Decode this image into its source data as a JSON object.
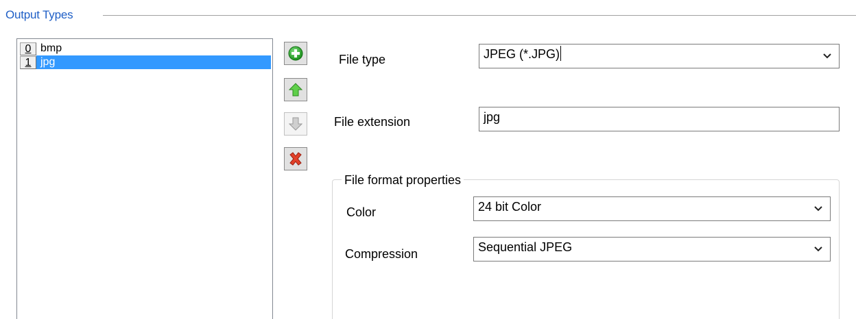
{
  "group": {
    "title": "Output Types"
  },
  "list": {
    "items": [
      {
        "index": "0",
        "label": "bmp",
        "selected": false
      },
      {
        "index": "1",
        "label": "jpg",
        "selected": true
      }
    ]
  },
  "toolbar": {
    "add_icon": "green-plus-circle-icon",
    "up_icon": "green-up-arrow-icon",
    "down_icon": "gray-down-arrow-icon",
    "delete_icon": "red-x-icon"
  },
  "form": {
    "file_type_label": "File type",
    "file_type_value": "JPEG (*.JPG)",
    "file_extension_label": "File extension",
    "file_extension_value": "jpg",
    "format_group_title": "File format properties",
    "color_label": "Color",
    "color_value": "24 bit Color",
    "compression_label": "Compression",
    "compression_value": "Sequential JPEG"
  },
  "colors": {
    "accent_title": "#1f5fc6",
    "selection": "#3399ff"
  }
}
